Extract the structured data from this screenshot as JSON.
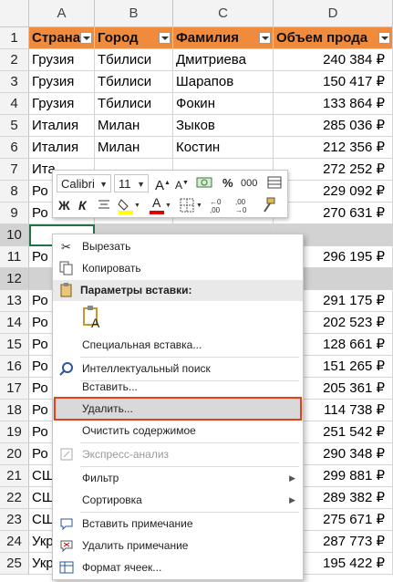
{
  "columns": [
    "A",
    "B",
    "C",
    "D"
  ],
  "table_headers": [
    "Страна",
    "Город",
    "Фамилия",
    "Объем прода"
  ],
  "rows": [
    {
      "n": "2",
      "a": "Грузия",
      "b": "Тбилиси",
      "c": "Дмитриева",
      "d": "240 384 ₽"
    },
    {
      "n": "3",
      "a": "Грузия",
      "b": "Тбилиси",
      "c": "Шарапов",
      "d": "150 417 ₽"
    },
    {
      "n": "4",
      "a": "Грузия",
      "b": "Тбилиси",
      "c": "Фокин",
      "d": "133 864 ₽"
    },
    {
      "n": "5",
      "a": "Италия",
      "b": "Милан",
      "c": "Зыков",
      "d": "285 036 ₽"
    },
    {
      "n": "6",
      "a": "Италия",
      "b": "Милан",
      "c": "Костин",
      "d": "212 356 ₽"
    },
    {
      "n": "7",
      "a": "Ита",
      "b": "",
      "c": "",
      "d": "272 252 ₽"
    },
    {
      "n": "8",
      "a": "Ро",
      "b": "",
      "c": "",
      "d": "229 092 ₽"
    },
    {
      "n": "9",
      "a": "Ро",
      "b": "",
      "c": "",
      "d": "270 631 ₽"
    },
    {
      "n": "10",
      "a": "",
      "b": "",
      "c": "",
      "d": ""
    },
    {
      "n": "11",
      "a": "Ро",
      "b": "",
      "c": "",
      "d": "296 195 ₽"
    },
    {
      "n": "12",
      "a": "",
      "b": "",
      "c": "",
      "d": ""
    },
    {
      "n": "13",
      "a": "Ро",
      "b": "",
      "c": "",
      "d": "291 175 ₽"
    },
    {
      "n": "14",
      "a": "Ро",
      "b": "",
      "c": "",
      "d": "202 523 ₽"
    },
    {
      "n": "15",
      "a": "Ро",
      "b": "",
      "c": "",
      "d": "128 661 ₽"
    },
    {
      "n": "16",
      "a": "Ро",
      "b": "",
      "c": "",
      "d": "151 265 ₽"
    },
    {
      "n": "17",
      "a": "Ро",
      "b": "",
      "c": "",
      "d": "205 361 ₽"
    },
    {
      "n": "18",
      "a": "Ро",
      "b": "",
      "c": "",
      "d": "114 738 ₽"
    },
    {
      "n": "19",
      "a": "Ро",
      "b": "",
      "c": "",
      "d": "251 542 ₽"
    },
    {
      "n": "20",
      "a": "Ро",
      "b": "",
      "c": "",
      "d": "290 348 ₽"
    },
    {
      "n": "21",
      "a": "СШ",
      "b": "",
      "c": "",
      "d": "299 881 ₽"
    },
    {
      "n": "22",
      "a": "СШ",
      "b": "",
      "c": "",
      "d": "289 382 ₽"
    },
    {
      "n": "23",
      "a": "СШ",
      "b": "",
      "c": "",
      "d": "275 671 ₽"
    },
    {
      "n": "24",
      "a": "Укр",
      "b": "",
      "c": "",
      "d": "287 773 ₽"
    },
    {
      "n": "25",
      "a": "Укр",
      "b": "",
      "c": "",
      "d": "195 422 ₽"
    }
  ],
  "mini_toolbar": {
    "font_name": "Calibri",
    "font_size": "11",
    "grow_font": "A",
    "shrink_font": "A",
    "percent": "%",
    "thousands": "000",
    "bold": "Ж",
    "italic": "К",
    "font_color_letter": "A"
  },
  "context_menu": {
    "cut": "Вырезать",
    "copy": "Копировать",
    "paste_options": "Параметры вставки:",
    "paste_icon_letter": "A",
    "paste_special": "Специальная вставка...",
    "smart_lookup": "Интеллектуальный поиск",
    "insert": "Вставить...",
    "delete": "Удалить...",
    "clear_contents": "Очистить содержимое",
    "quick_analysis": "Экспресс-анализ",
    "filter": "Фильтр",
    "sort": "Сортировка",
    "insert_comment": "Вставить примечание",
    "delete_comment": "Удалить примечание",
    "format_cells": "Формат ячеек..."
  },
  "colors": {
    "header_fill": "#f08a3c",
    "selection_border": "#217346",
    "highlight_box": "#e0431b"
  }
}
